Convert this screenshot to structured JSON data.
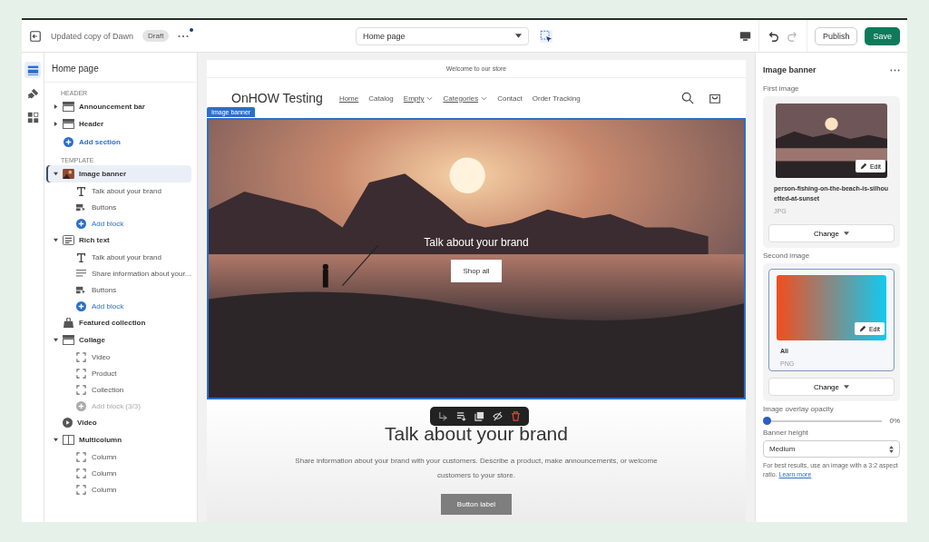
{
  "topbar": {
    "theme_name": "Updated copy of Dawn",
    "status": "Draft",
    "unsaved_dot": true,
    "page_select": "Home page",
    "publish": "Publish",
    "save": "Save"
  },
  "rail": [
    {
      "kind": "sections",
      "selected": true
    },
    {
      "kind": "brush",
      "selected": false
    },
    {
      "kind": "apps",
      "selected": false
    }
  ],
  "sidebar": {
    "title": "Home page",
    "groups": [
      {
        "heading": "HEADER",
        "add": "Add section",
        "sections": [
          {
            "label": "Announcement bar",
            "kind": "bar",
            "expanded": false,
            "selected": false
          },
          {
            "label": "Header",
            "kind": "bar",
            "expanded": false,
            "selected": false
          }
        ]
      },
      {
        "heading": "TEMPLATE",
        "sections": [
          {
            "label": "Image banner",
            "kind": "image",
            "expanded": true,
            "selected": true,
            "children": [
              {
                "label": "Talk about your brand",
                "kind": "text",
                "disabled": false
              },
              {
                "label": "Buttons",
                "kind": "buttons",
                "disabled": false
              },
              {
                "label": "Add block",
                "kind": "add",
                "disabled": false
              }
            ]
          },
          {
            "label": "Rich text",
            "kind": "richtext",
            "expanded": true,
            "selected": false,
            "children": [
              {
                "label": "Talk about your brand",
                "kind": "text",
                "disabled": false
              },
              {
                "label": "Share information about your...",
                "kind": "paragraph",
                "disabled": false
              },
              {
                "label": "Buttons",
                "kind": "buttons",
                "disabled": false
              },
              {
                "label": "Add block",
                "kind": "add",
                "disabled": false
              }
            ]
          },
          {
            "label": "Featured collection",
            "kind": "bag",
            "selected": false
          },
          {
            "label": "Collage",
            "kind": "bar",
            "expanded": true,
            "selected": false,
            "children": [
              {
                "label": "Video",
                "kind": "placeholder",
                "disabled": false
              },
              {
                "label": "Product",
                "kind": "placeholder",
                "disabled": false
              },
              {
                "label": "Collection",
                "kind": "placeholder",
                "disabled": false
              },
              {
                "label": "Add block (3/3)",
                "kind": "add",
                "disabled": true
              }
            ]
          },
          {
            "label": "Video",
            "kind": "play",
            "selected": false
          },
          {
            "label": "Multicolumn",
            "kind": "columns",
            "expanded": true,
            "selected": false,
            "children": [
              {
                "label": "Column",
                "kind": "placeholder",
                "disabled": false
              },
              {
                "label": "Column",
                "kind": "placeholder",
                "disabled": false
              },
              {
                "label": "Column",
                "kind": "placeholder",
                "disabled": false
              }
            ]
          }
        ]
      }
    ]
  },
  "preview": {
    "announcement": "Welcome to our store",
    "logo": "OnHOW Testing",
    "nav": [
      {
        "label": "Home",
        "underlined": true,
        "dropdown": false
      },
      {
        "label": "Catalog",
        "underlined": false,
        "dropdown": false
      },
      {
        "label": "Empty",
        "underlined": true,
        "dropdown": true
      },
      {
        "label": "Categories",
        "underlined": true,
        "dropdown": true
      },
      {
        "label": "Contact",
        "underlined": false,
        "dropdown": false
      },
      {
        "label": "Order Tracking",
        "underlined": false,
        "dropdown": false
      }
    ],
    "banner": {
      "tag": "Image banner",
      "heading": "Talk about your brand",
      "button": "Shop all"
    },
    "block_toolbar": [
      {
        "kind": "move"
      },
      {
        "kind": "reorder"
      },
      {
        "kind": "duplicate"
      },
      {
        "kind": "hide"
      },
      {
        "kind": "delete"
      }
    ],
    "rich_text": {
      "heading": "Talk about your brand",
      "body": "Share information about your brand with your customers. Describe a product, make announcements, or welcome customers to your store.",
      "button": "Button label"
    }
  },
  "settings": {
    "title": "Image banner",
    "images": [
      {
        "label": "First image",
        "kind": "photo",
        "selected": false,
        "edit": "Edit",
        "filename": "person-fishing-on-the-beach-is-silhouetted-at-sunset",
        "format": "JPG",
        "change": "Change"
      },
      {
        "label": "Second image",
        "kind": "gradient",
        "selected": true,
        "edit": "Edit",
        "filename": "Ali",
        "format": "PNG",
        "change": "Change"
      }
    ],
    "opacity": {
      "label": "Image overlay opacity",
      "level": 0,
      "reading": "0%"
    },
    "height": {
      "label": "Banner height",
      "value": "Medium"
    },
    "help": {
      "text": "For best results, use an image with a 3:2 aspect ratio.",
      "link": "Learn more"
    }
  }
}
